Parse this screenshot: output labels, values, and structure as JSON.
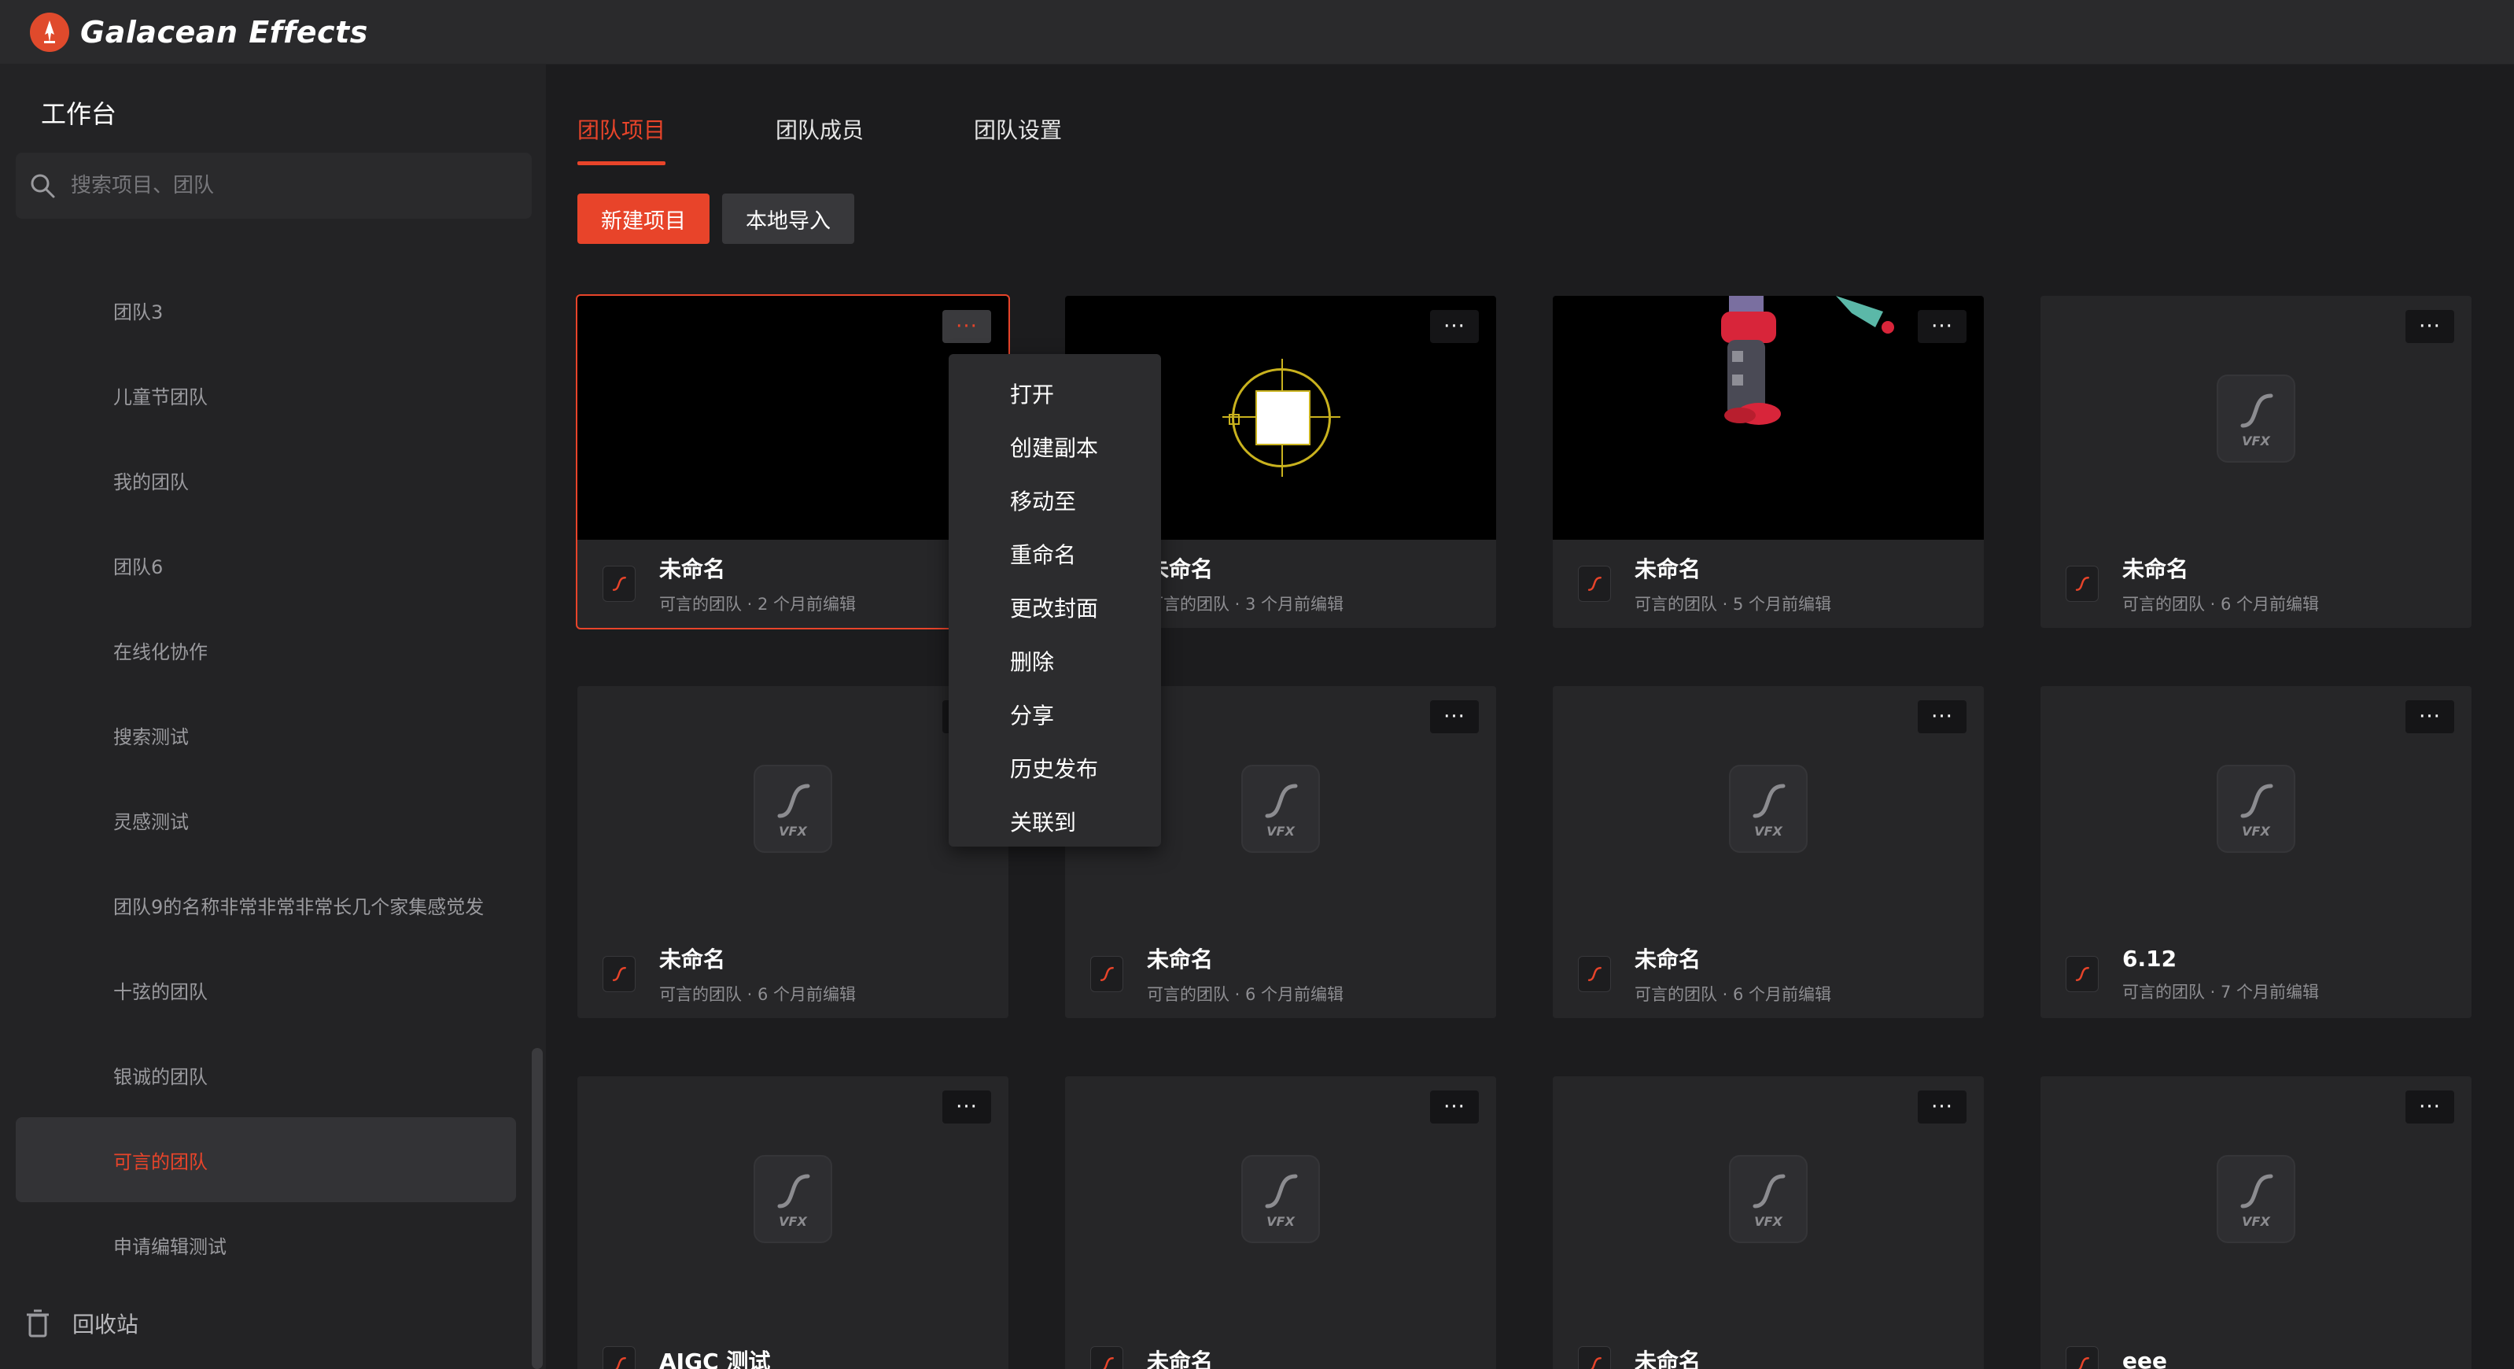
{
  "app": {
    "brand": "Galacean Effects"
  },
  "sidebar": {
    "title": "工作台",
    "search_placeholder": "搜索项目、团队",
    "teams": [
      {
        "label": "团队3",
        "active": false
      },
      {
        "label": "儿童节团队",
        "active": false
      },
      {
        "label": "我的团队",
        "active": false
      },
      {
        "label": "团队6",
        "active": false
      },
      {
        "label": "在线化协作",
        "active": false
      },
      {
        "label": "搜索测试",
        "active": false
      },
      {
        "label": "灵感测试",
        "active": false
      },
      {
        "label": "团队9的名称非常非常非常长几个家集感觉发",
        "active": false
      },
      {
        "label": "十弦的团队",
        "active": false
      },
      {
        "label": "银诚的团队",
        "active": false
      },
      {
        "label": "可言的团队",
        "active": true
      },
      {
        "label": "申请编辑测试",
        "active": false
      }
    ],
    "trash_label": "回收站"
  },
  "tabs": [
    {
      "label": "团队项目",
      "active": true
    },
    {
      "label": "团队成员",
      "active": false
    },
    {
      "label": "团队设置",
      "active": false
    }
  ],
  "actions": {
    "new_project": "新建项目",
    "local_import": "本地导入"
  },
  "projects": [
    {
      "title": "未命名",
      "subtitle": "可言的团队 · 2 个月前编辑",
      "thumb": "blank-black",
      "selected": true
    },
    {
      "title": "未命名",
      "subtitle": "可言的团队 · 3 个月前编辑",
      "thumb": "target-scene",
      "selected": false
    },
    {
      "title": "未命名",
      "subtitle": "可言的团队 · 5 个月前编辑",
      "thumb": "robot-scene",
      "selected": false
    },
    {
      "title": "未命名",
      "subtitle": "可言的团队 · 6 个月前编辑",
      "thumb": "vfx-placeholder",
      "selected": false
    },
    {
      "title": "未命名",
      "subtitle": "可言的团队 · 6 个月前编辑",
      "thumb": "vfx-placeholder",
      "selected": false
    },
    {
      "title": "未命名",
      "subtitle": "可言的团队 · 6 个月前编辑",
      "thumb": "vfx-placeholder",
      "selected": false
    },
    {
      "title": "未命名",
      "subtitle": "可言的团队 · 6 个月前编辑",
      "thumb": "vfx-placeholder",
      "selected": false
    },
    {
      "title": "6.12",
      "subtitle": "可言的团队 · 7 个月前编辑",
      "thumb": "vfx-placeholder",
      "selected": false
    },
    {
      "title": "AIGC 测试",
      "subtitle": "",
      "thumb": "vfx-placeholder",
      "selected": false
    },
    {
      "title": "未命名",
      "subtitle": "",
      "thumb": "vfx-placeholder",
      "selected": false
    },
    {
      "title": "未命名",
      "subtitle": "",
      "thumb": "vfx-placeholder",
      "selected": false
    },
    {
      "title": "eee",
      "subtitle": "",
      "thumb": "vfx-placeholder",
      "selected": false
    }
  ],
  "placeholder_text": "VFX",
  "more_glyph": "···",
  "context_menu": {
    "items": [
      "打开",
      "创建副本",
      "移动至",
      "重命名",
      "更改封面",
      "删除",
      "分享",
      "历史发布",
      "关联到"
    ]
  },
  "colors": {
    "accent": "#e8442a",
    "background": "#1c1c1e",
    "sidebar": "#232325",
    "card": "#262628"
  }
}
